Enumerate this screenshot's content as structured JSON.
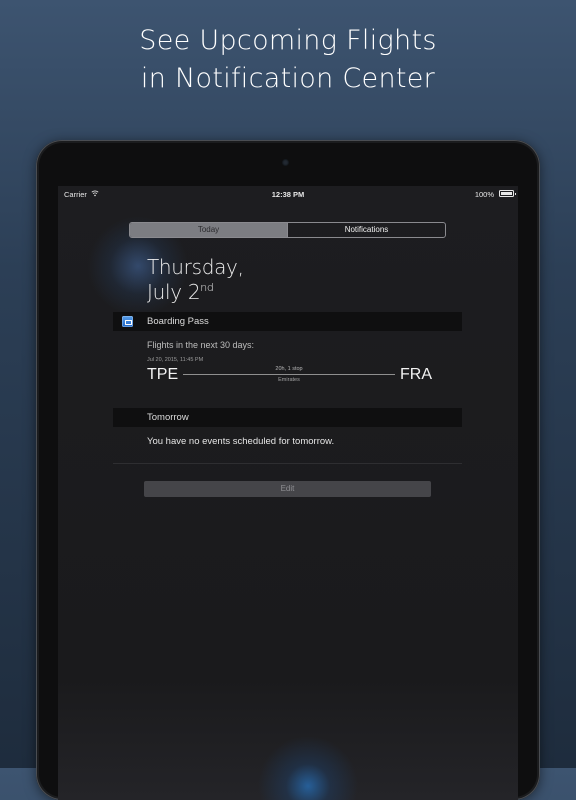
{
  "headline": {
    "line1": "See Upcoming Flights",
    "line2": "in Notification Center"
  },
  "status_bar": {
    "carrier": "Carrier",
    "time": "12:38 PM",
    "battery": "100%"
  },
  "tabs": [
    {
      "label": "Today",
      "selected": true
    },
    {
      "label": "Notifications",
      "selected": false
    }
  ],
  "date": {
    "weekday": "Thursday,",
    "month_day": "July 2",
    "suffix": "nd"
  },
  "boarding_pass": {
    "title": "Boarding Pass",
    "subtitle": "Flights in the next 30 days:",
    "flight": {
      "date": "Jul 20, 2015, 11:45 PM",
      "origin": "TPE",
      "destination": "FRA",
      "duration": "20h, 1 stop",
      "airline": "Emirates"
    }
  },
  "tomorrow": {
    "title": "Tomorrow",
    "message": "You have no events scheduled for tomorrow."
  },
  "edit_label": "Edit",
  "colors": {
    "background_top": "#3d5470",
    "background_bottom": "#1e2c3d",
    "app_icon_blue": "#1f64c4"
  }
}
